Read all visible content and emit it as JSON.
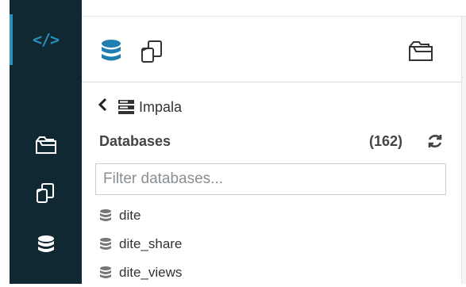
{
  "rail": {
    "items": [
      {
        "name": "editor",
        "icon": "code-icon",
        "glyph": "</>",
        "active": true
      },
      {
        "name": "files",
        "icon": "folder-icon"
      },
      {
        "name": "documents",
        "icon": "documents-icon"
      },
      {
        "name": "tables",
        "icon": "database-icon"
      }
    ],
    "accent_color": "#2a8fbd",
    "background": "#0f2832"
  },
  "assist_header": {
    "tabs": [
      {
        "icon": "database-icon",
        "active": true
      },
      {
        "icon": "documents-icon"
      },
      {
        "icon": "folder-icon"
      }
    ]
  },
  "breadcrumb": {
    "back_glyph": "‹",
    "source_label": "Impala"
  },
  "databases": {
    "title": "Databases",
    "count": "(162)",
    "filter_placeholder": "Filter databases...",
    "items": [
      "dite",
      "dite_share",
      "dite_views"
    ]
  }
}
